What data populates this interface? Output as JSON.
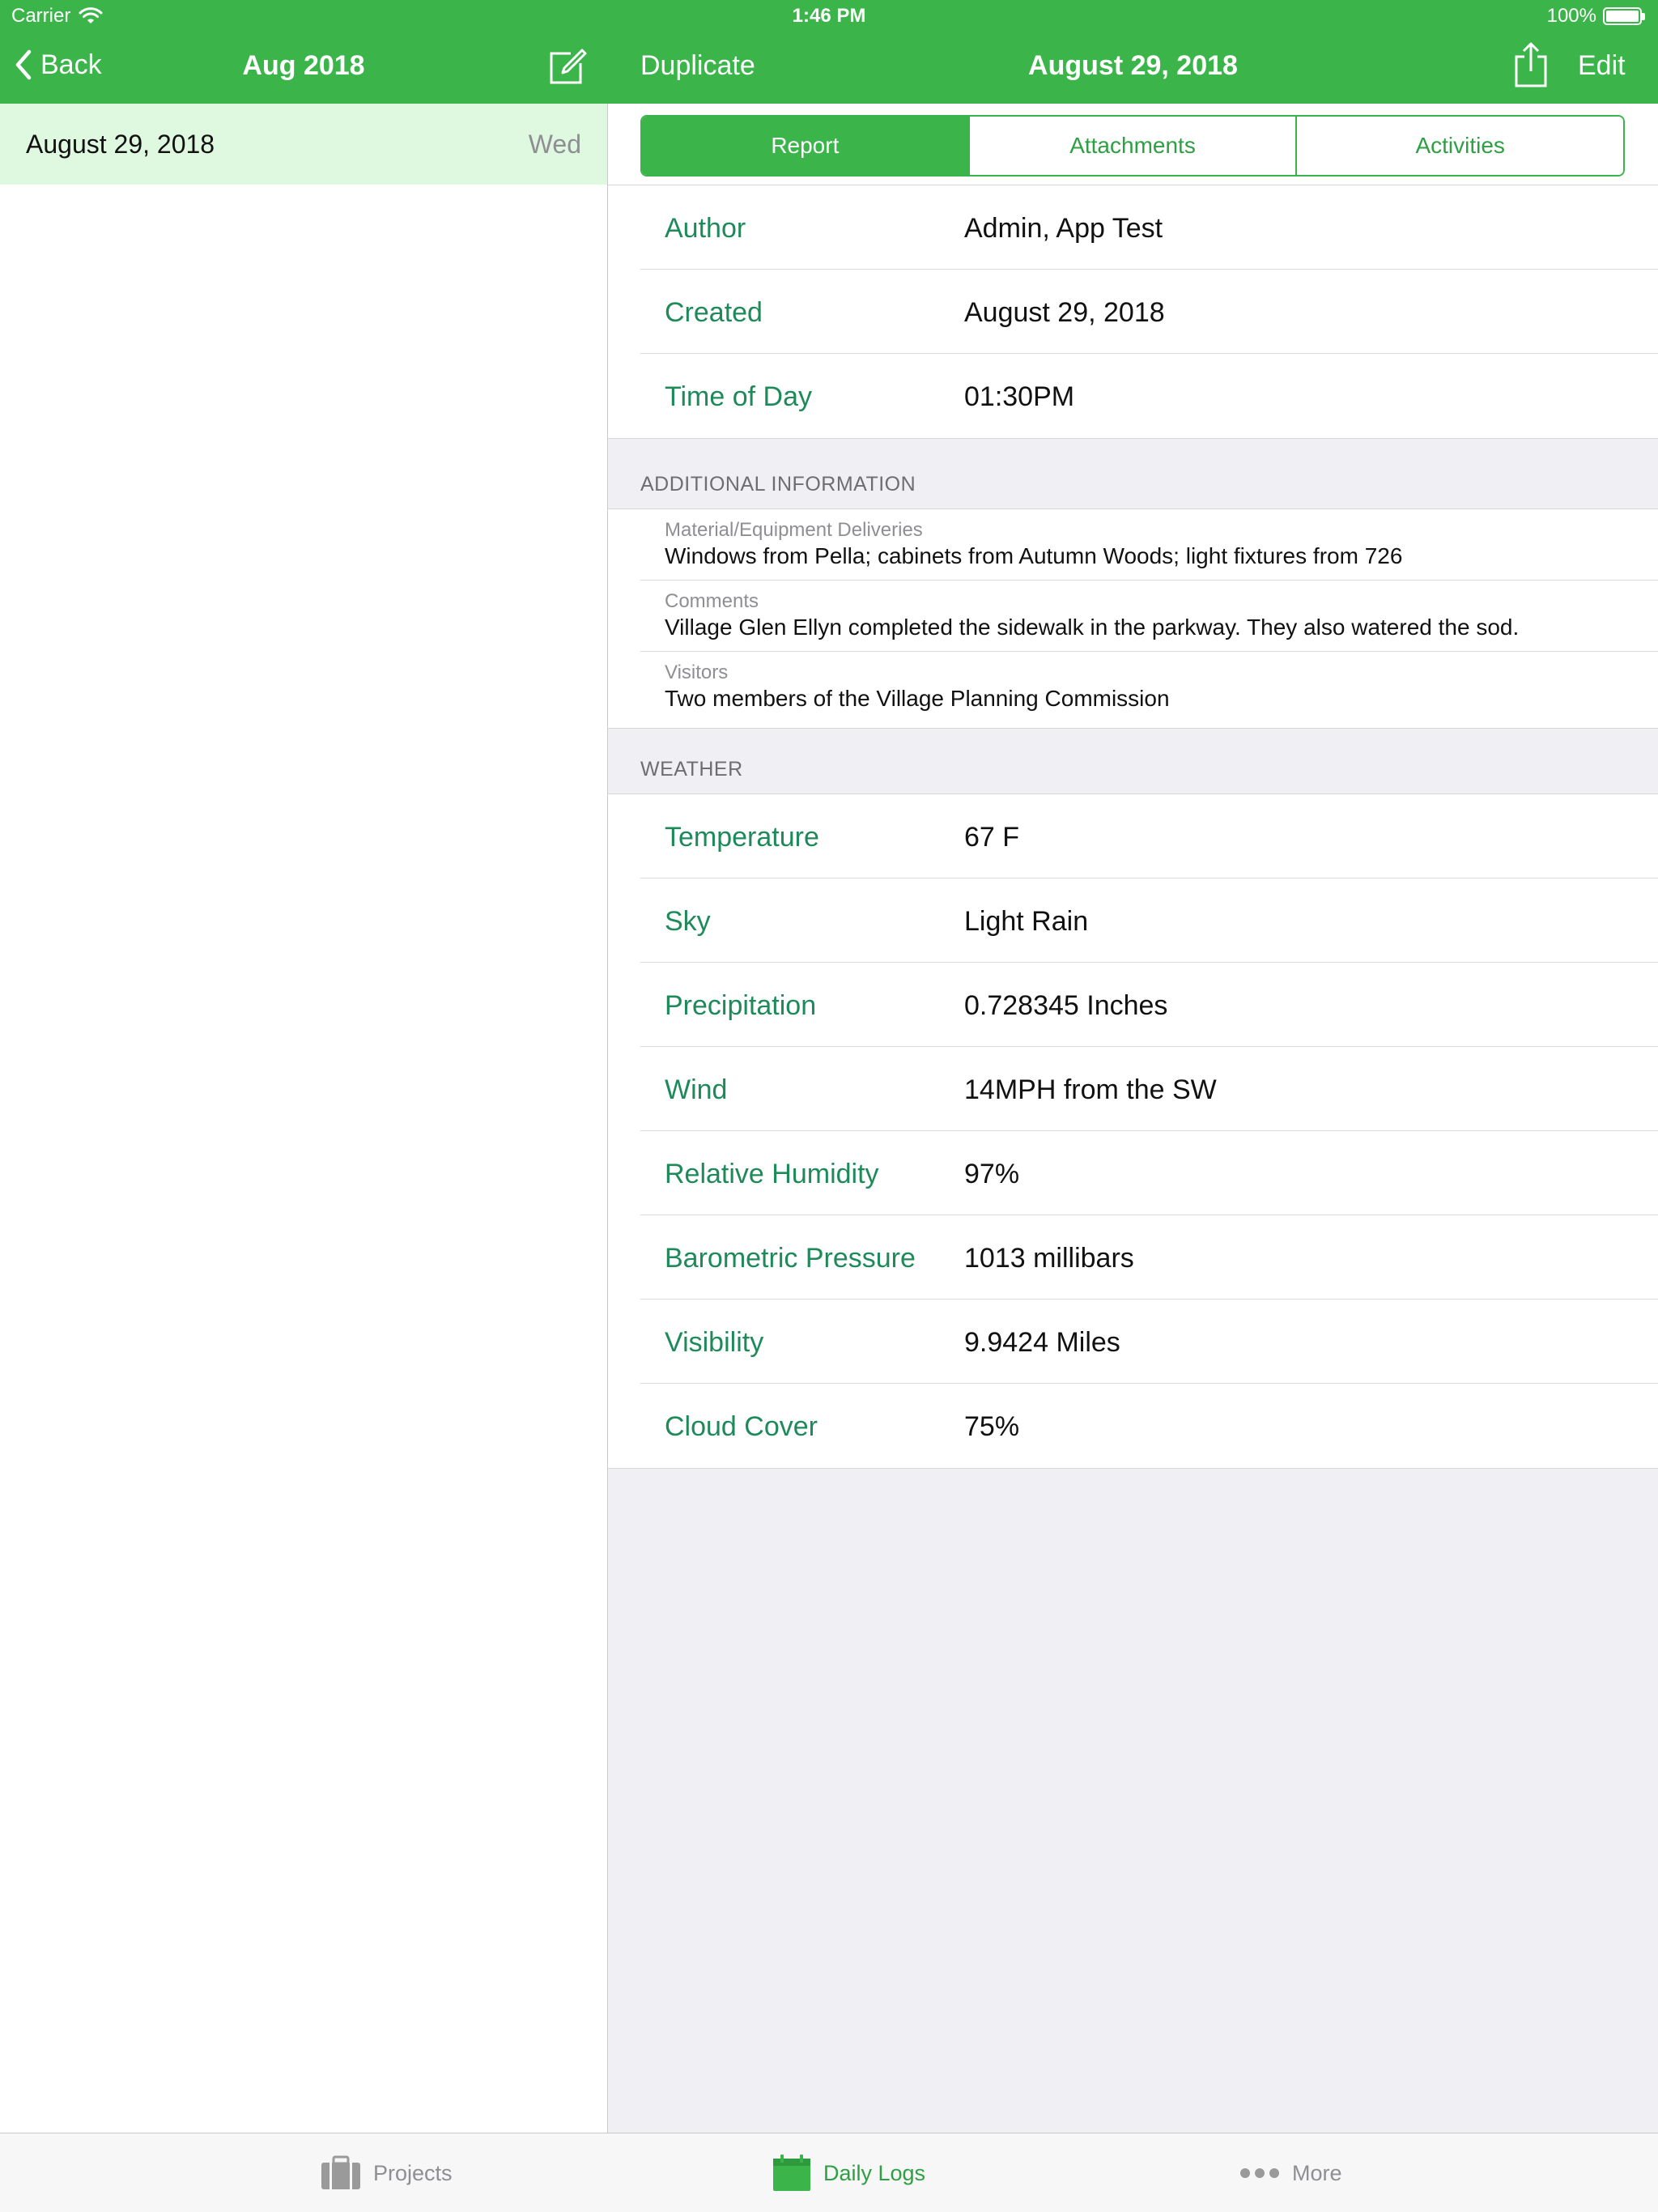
{
  "status_bar": {
    "carrier": "Carrier",
    "time": "1:46 PM",
    "battery": "100%"
  },
  "master_nav": {
    "back_label": "Back",
    "title": "Aug 2018"
  },
  "master_list": {
    "items": [
      {
        "date": "August 29, 2018",
        "day": "Wed"
      }
    ]
  },
  "detail_nav": {
    "duplicate_label": "Duplicate",
    "title": "August 29, 2018",
    "edit_label": "Edit"
  },
  "segments": {
    "items": [
      "Report",
      "Attachments",
      "Activities"
    ],
    "selected": "Report"
  },
  "report": {
    "fields": [
      {
        "key": "Author",
        "value": "Admin, App Test"
      },
      {
        "key": "Created",
        "value": "August 29, 2018"
      },
      {
        "key": "Time of Day",
        "value": "01:30PM"
      }
    ]
  },
  "additional_info": {
    "header": "ADDITIONAL INFORMATION",
    "items": [
      {
        "label": "Material/Equipment Deliveries",
        "text": "Windows from Pella; cabinets from Autumn Woods; light fixtures from 726"
      },
      {
        "label": "Comments",
        "text": "Village Glen Ellyn completed the sidewalk in the parkway. They also watered the sod."
      },
      {
        "label": "Visitors",
        "text": "Two members of the Village Planning Commission"
      }
    ]
  },
  "weather": {
    "header": "WEATHER",
    "fields": [
      {
        "key": "Temperature",
        "value": "67 F"
      },
      {
        "key": "Sky",
        "value": "Light Rain"
      },
      {
        "key": "Precipitation",
        "value": "0.728345 Inches"
      },
      {
        "key": "Wind",
        "value": "14MPH from the SW"
      },
      {
        "key": "Relative Humidity",
        "value": "97%"
      },
      {
        "key": "Barometric Pressure",
        "value": "1013 millibars"
      },
      {
        "key": "Visibility",
        "value": "9.9424 Miles"
      },
      {
        "key": "Cloud Cover",
        "value": "75%"
      }
    ]
  },
  "tab_bar": {
    "items": [
      {
        "label": "Projects",
        "icon": "briefcase-icon"
      },
      {
        "label": "Daily Logs",
        "icon": "calendar-icon"
      },
      {
        "label": "More",
        "icon": "more-dots-icon"
      }
    ],
    "selected": "Daily Logs"
  },
  "colors": {
    "brand_green": "#3bb54a",
    "label_green": "#1e8a5a",
    "selected_row": "#dff8e0"
  }
}
